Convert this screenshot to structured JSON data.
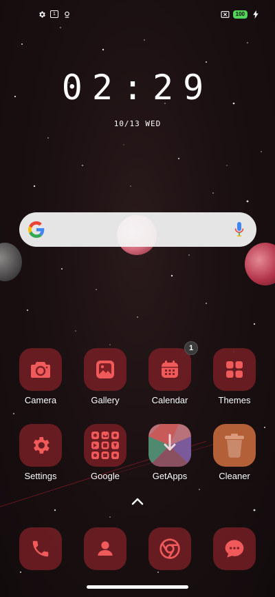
{
  "status_bar": {
    "left_icons": [
      "gear-icon",
      "calendar-icon",
      "location-icon"
    ],
    "calendar_day": "1",
    "battery": "100",
    "battery_color": "#52d35a"
  },
  "clock": {
    "time": "02:29",
    "date": "10/13 WED"
  },
  "search": {
    "mic_color": "#4285F4"
  },
  "theme": {
    "accent": "#f05a5a",
    "icon_bg": "#7e2026"
  },
  "apps": [
    {
      "label": "Camera"
    },
    {
      "label": "Gallery"
    },
    {
      "label": "Calendar",
      "badge": "1"
    },
    {
      "label": "Themes"
    },
    {
      "label": "Settings"
    },
    {
      "label": "Google"
    },
    {
      "label": "GetApps"
    },
    {
      "label": "Cleaner"
    }
  ],
  "dock": [
    "phone-icon",
    "contacts-icon",
    "chrome-icon",
    "messages-icon"
  ]
}
